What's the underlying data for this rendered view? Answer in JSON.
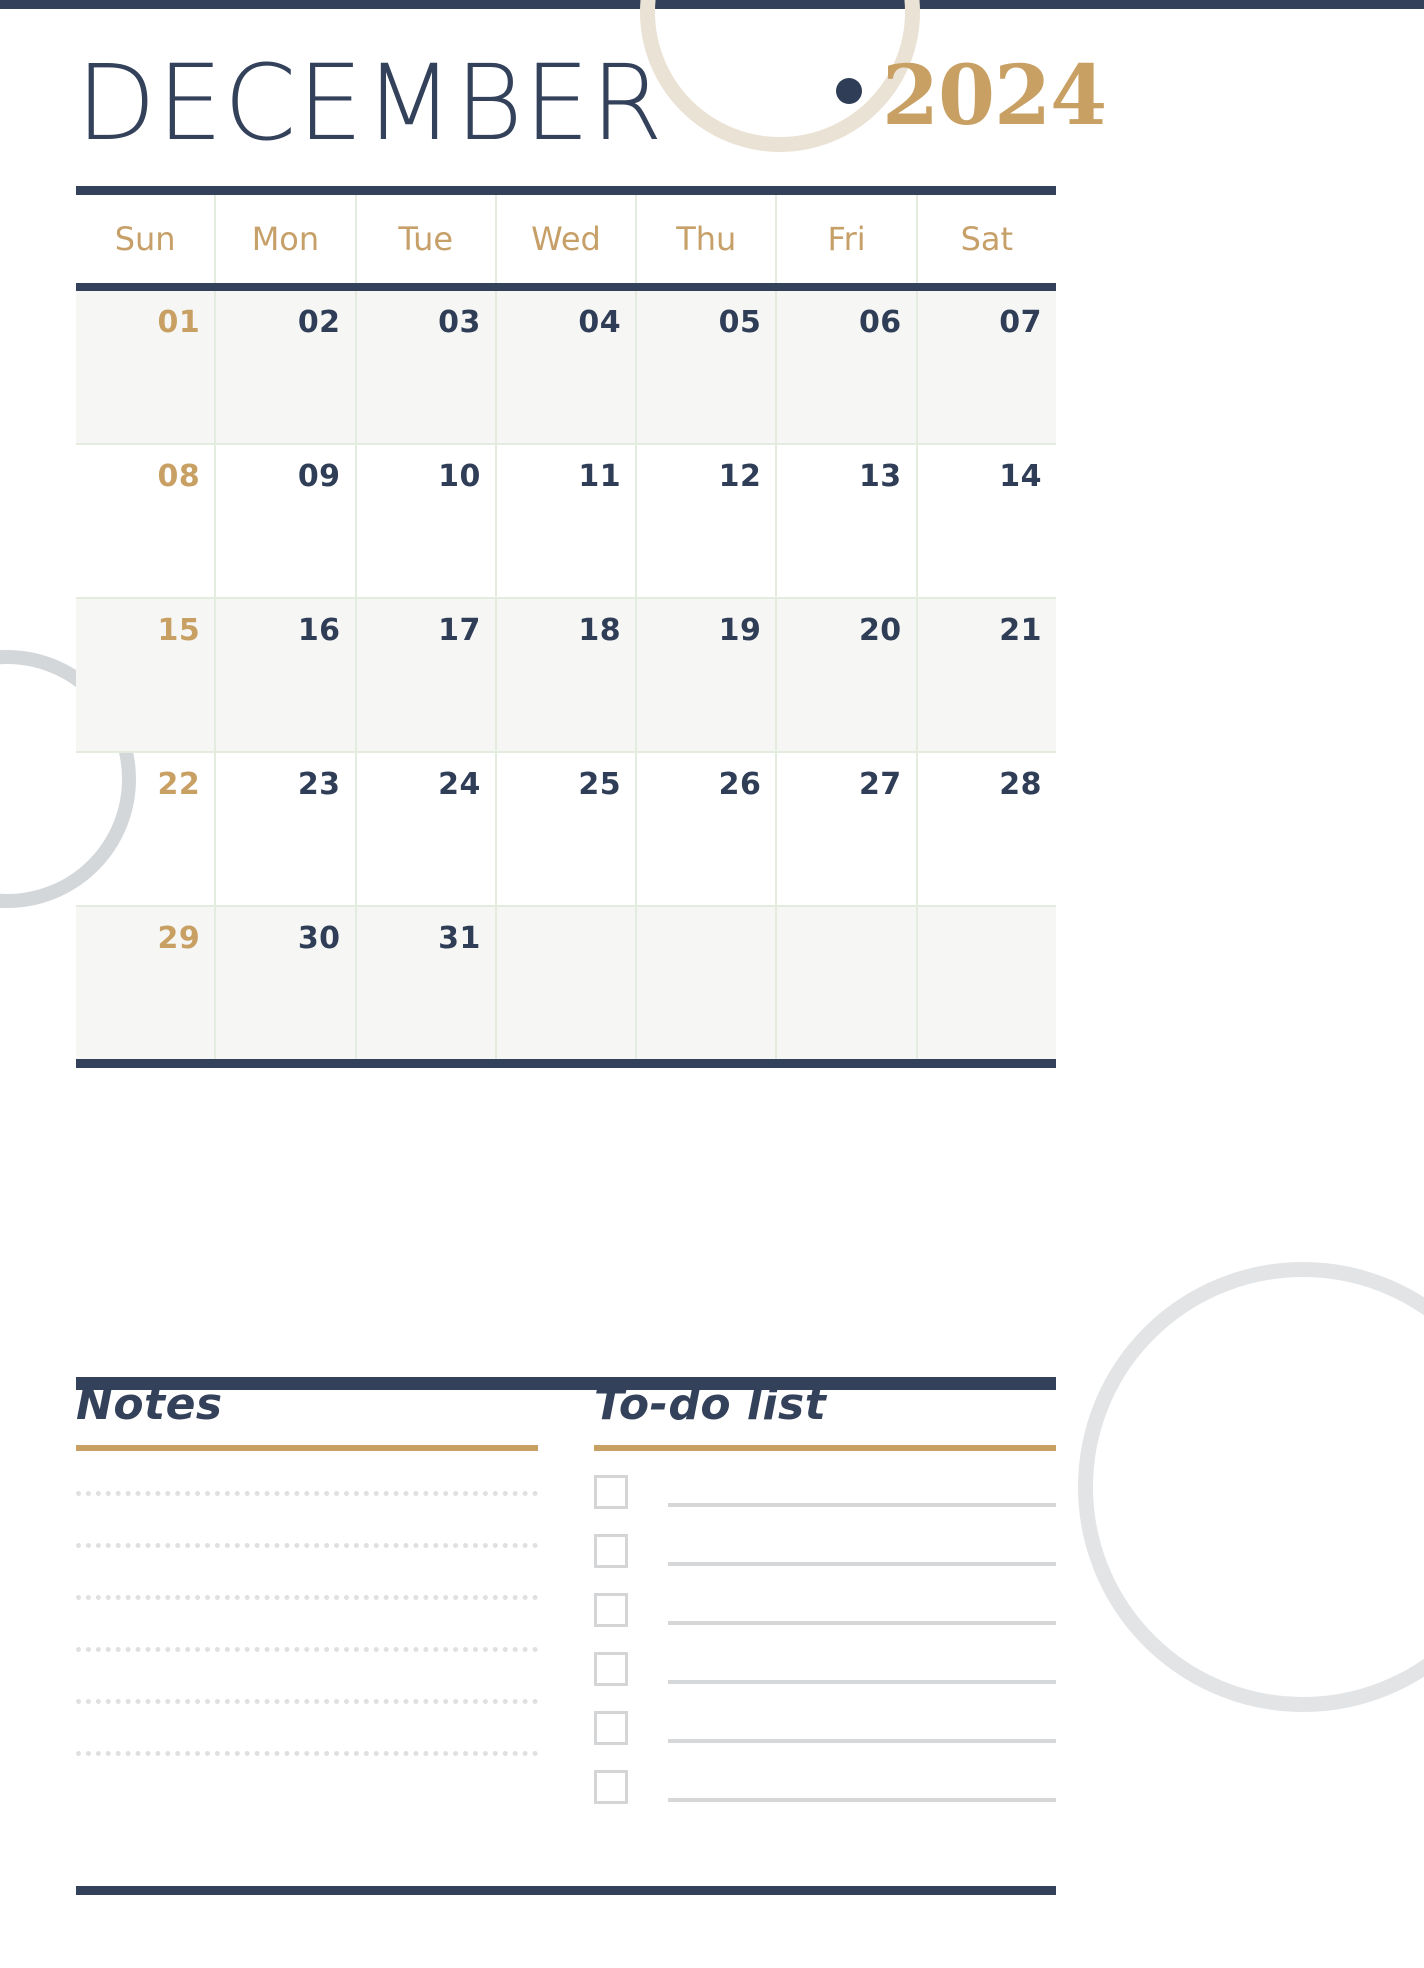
{
  "page": {
    "month": "DECEMBER",
    "year": "2024",
    "colors": {
      "navy": "#33415a",
      "gold": "#c9a063",
      "cream": "#eae2d4",
      "sage_grid": "#e4ece0",
      "row_shade": "#f6f7f5",
      "gray_line": "#d6d7d8"
    }
  },
  "calendar": {
    "weekdays": [
      "Sun",
      "Mon",
      "Tue",
      "Wed",
      "Thu",
      "Fri",
      "Sat"
    ],
    "rows": [
      {
        "shaded": true,
        "days": [
          "01",
          "02",
          "03",
          "04",
          "05",
          "06",
          "07"
        ]
      },
      {
        "shaded": false,
        "days": [
          "08",
          "09",
          "10",
          "11",
          "12",
          "13",
          "14"
        ]
      },
      {
        "shaded": true,
        "days": [
          "15",
          "16",
          "17",
          "18",
          "19",
          "20",
          "21"
        ]
      },
      {
        "shaded": false,
        "days": [
          "22",
          "23",
          "24",
          "25",
          "26",
          "27",
          "28"
        ]
      },
      {
        "shaded": true,
        "days": [
          "29",
          "30",
          "31",
          "",
          "",
          "",
          ""
        ]
      }
    ]
  },
  "notes": {
    "title": "Notes",
    "line_count": 6
  },
  "todo": {
    "title": "To-do list",
    "item_count": 6
  }
}
